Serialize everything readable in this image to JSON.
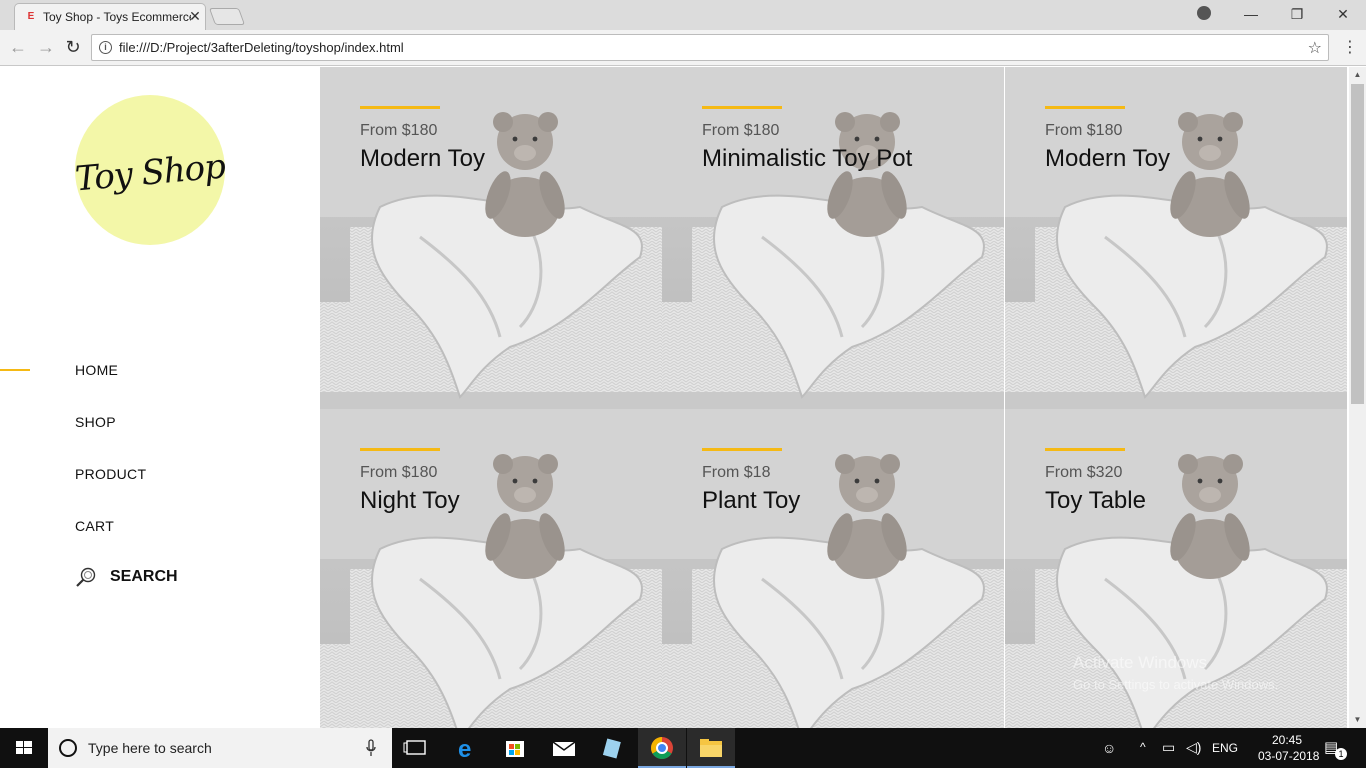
{
  "browser": {
    "tab_title": "Toy Shop - Toys Ecommerce",
    "tab_favicon": "E",
    "tab_close": "✕",
    "url": "file:///D:/Project/3afterDeleting/toyshop/index.html"
  },
  "sidebar": {
    "logo": "Toy Shop",
    "nav": [
      {
        "label": "HOME"
      },
      {
        "label": "SHOP"
      },
      {
        "label": "PRODUCT"
      },
      {
        "label": "CART"
      }
    ],
    "search_label": "SEARCH"
  },
  "products": [
    {
      "price": "From $180",
      "name": "Modern Toy"
    },
    {
      "price": "From $180",
      "name": "Minimalistic Toy Pot"
    },
    {
      "price": "From $180",
      "name": "Modern Toy"
    },
    {
      "price": "From $180",
      "name": "Night Toy"
    },
    {
      "price": "From $18",
      "name": "Plant Toy"
    },
    {
      "price": "From $320",
      "name": "Toy Table"
    }
  ],
  "watermark": {
    "line1": "Activate Windows",
    "line2": "Go to Settings to activate Windows."
  },
  "taskbar": {
    "search_placeholder": "Type here to search",
    "language": "ENG",
    "time": "20:45",
    "date": "03-07-2018",
    "notification_count": "1"
  },
  "colors": {
    "accent": "#f5b914",
    "logo_bg": "#f3f7a8"
  }
}
